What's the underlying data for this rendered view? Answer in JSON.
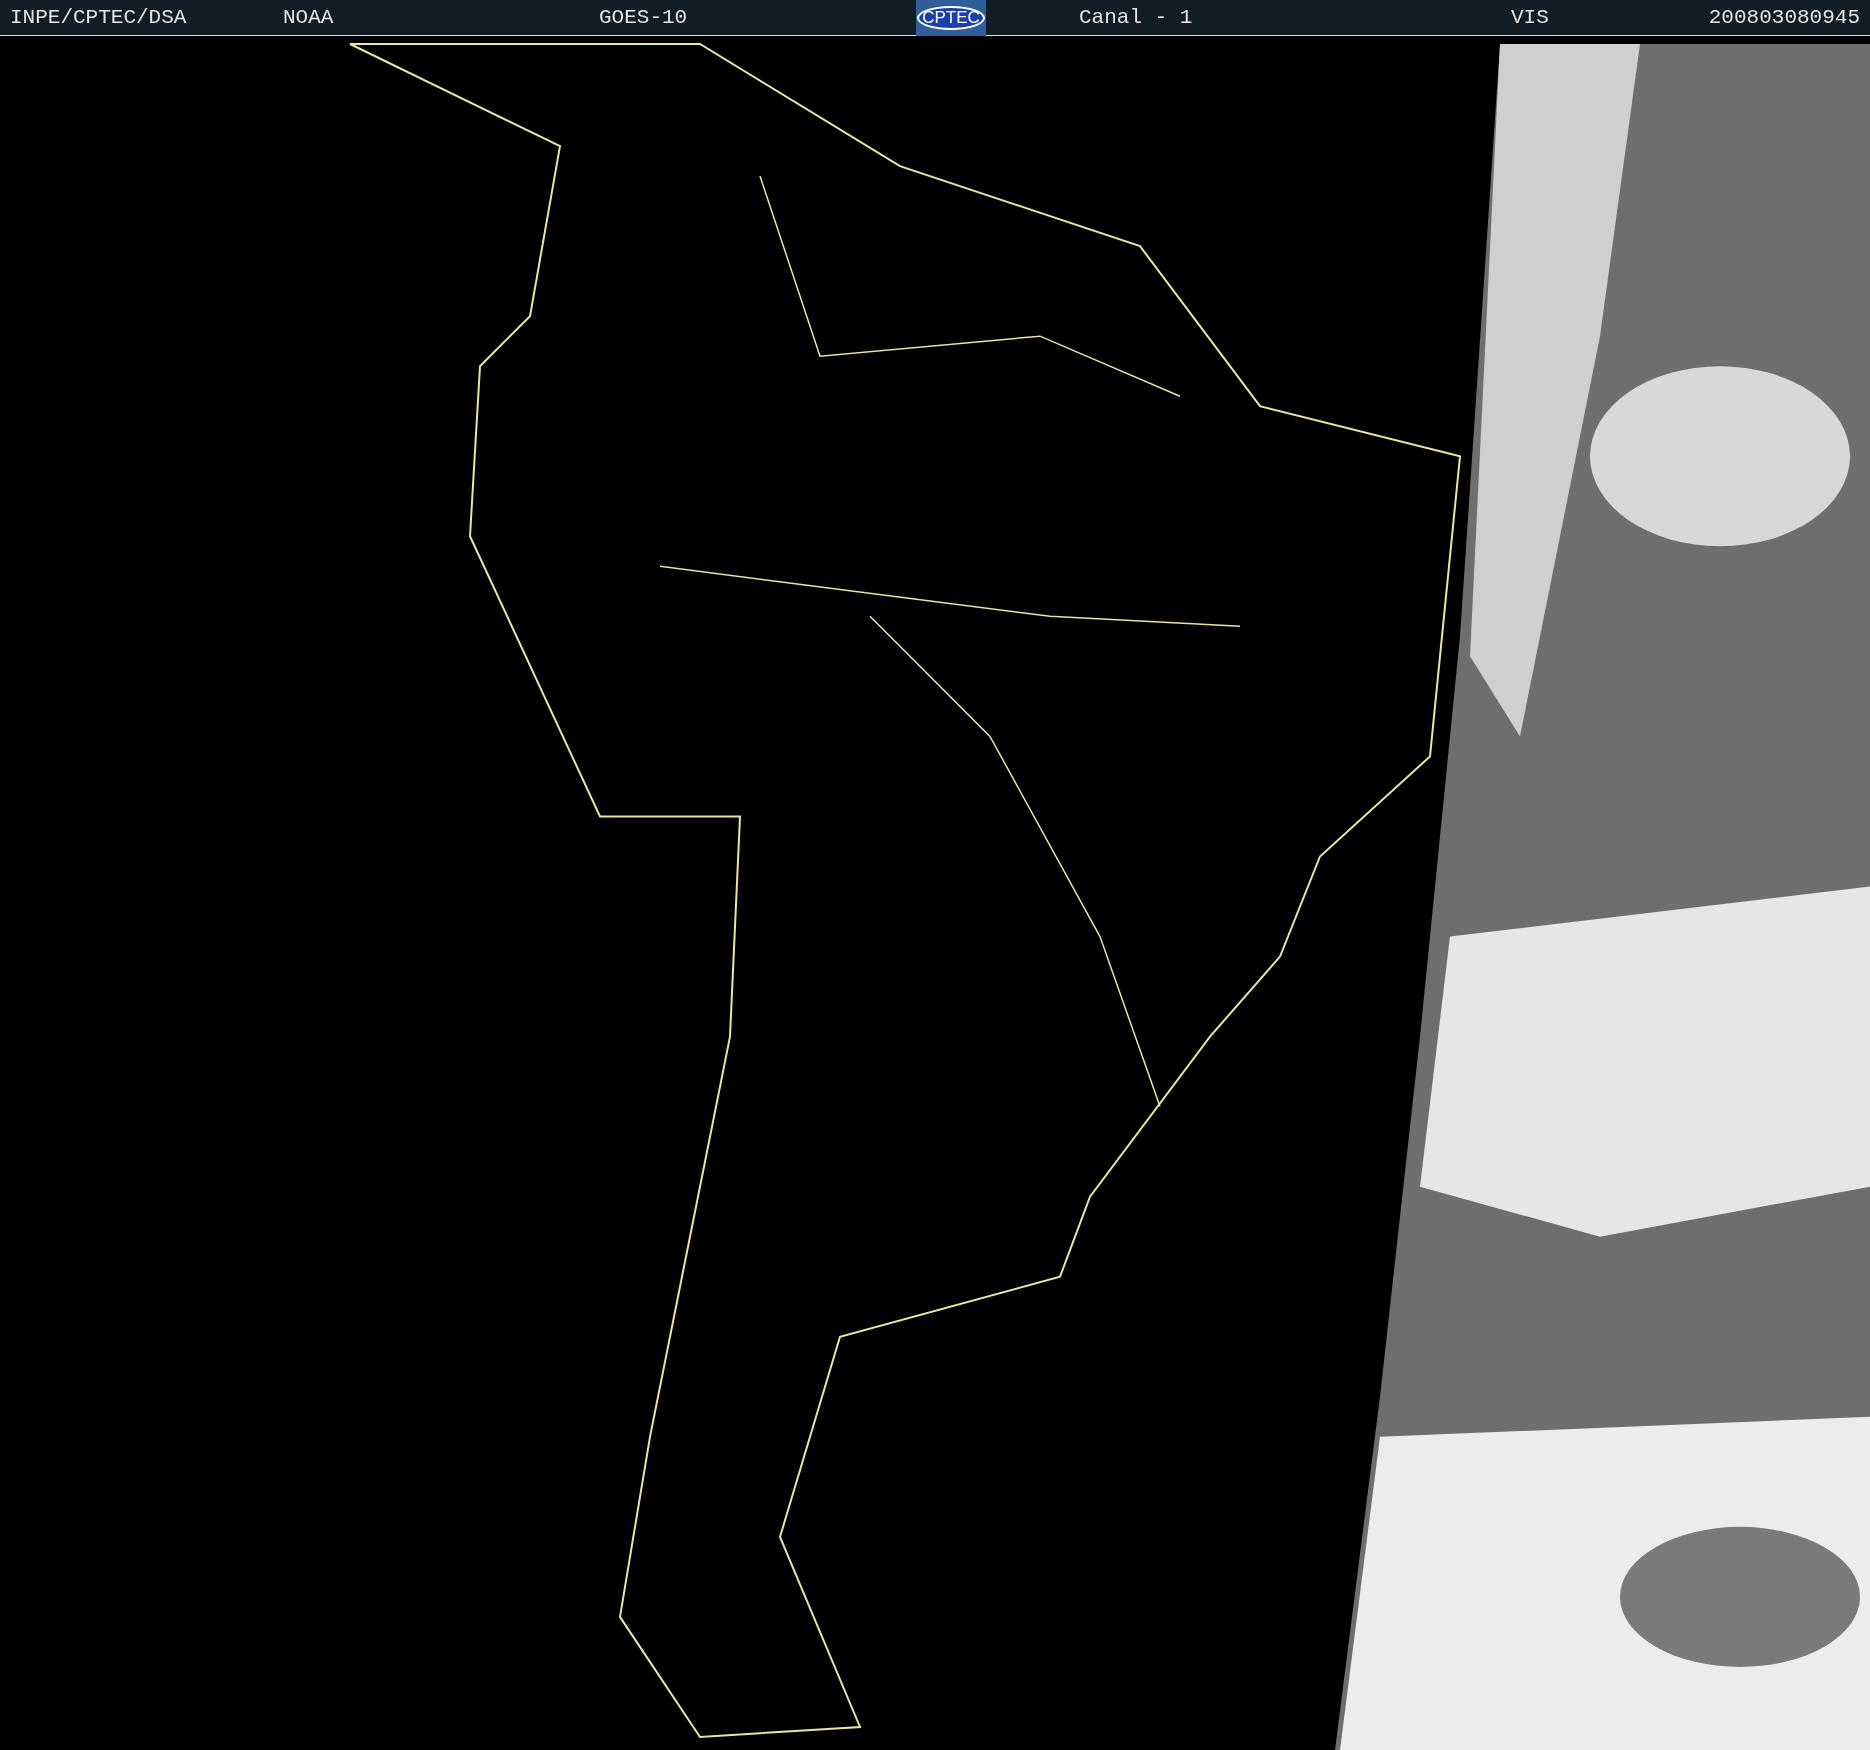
{
  "header": {
    "source": "INPE/CPTEC/DSA",
    "agency": "NOAA",
    "satellite": "GOES-10",
    "logo": "CPTEC",
    "channel": "Canal - 1",
    "band": "VIS",
    "timestamp": "200803080945"
  }
}
